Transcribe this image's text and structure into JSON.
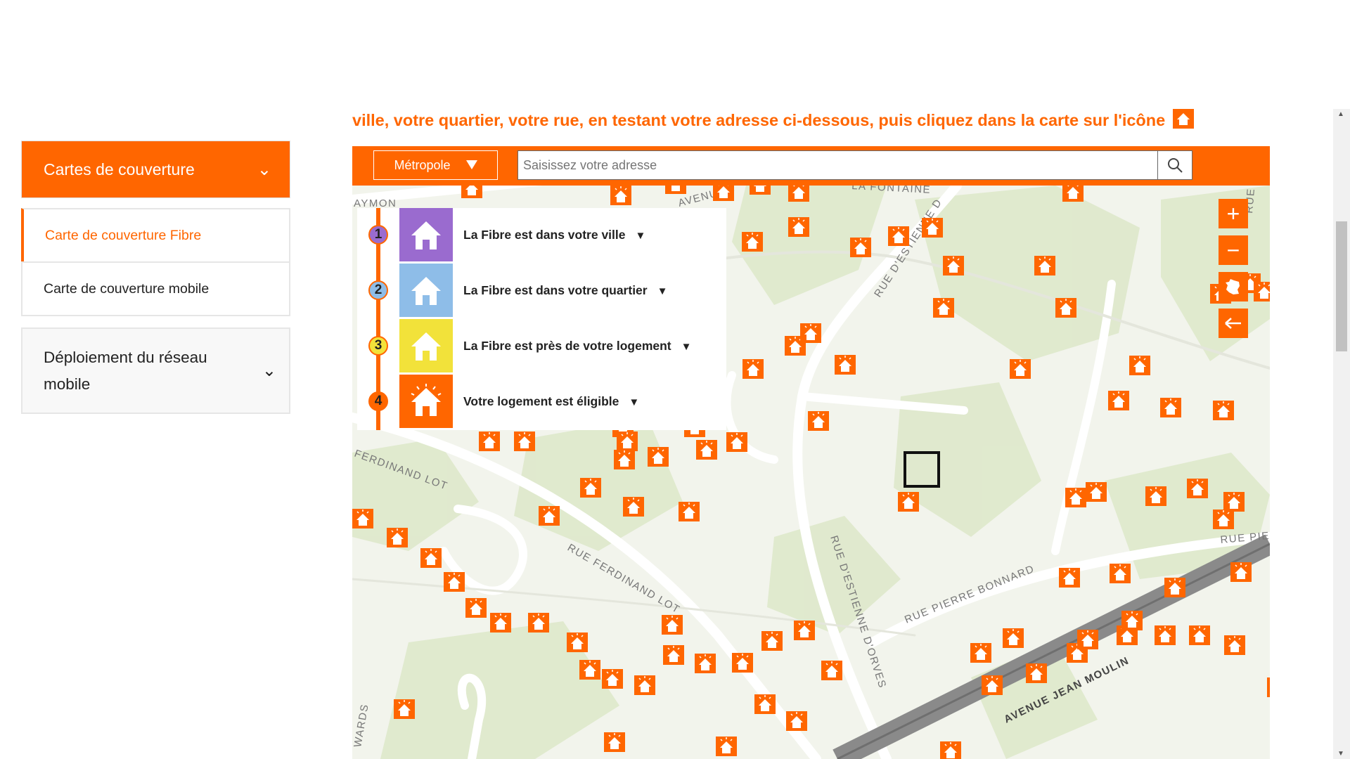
{
  "sidebar": {
    "header": "Cartes de couverture",
    "items": [
      {
        "label": "Carte de couverture Fibre"
      },
      {
        "label": "Carte de couverture mobile"
      }
    ],
    "section2": "Déploiement du réseau mobile"
  },
  "intro": "ville, votre quartier, votre rue, en testant votre adresse ci-dessous, puis cliquez dans la carte sur l'icône",
  "search": {
    "region": "Métropole",
    "placeholder": "Saisissez votre adresse"
  },
  "legend": [
    {
      "num": "1",
      "label": "La Fibre est dans votre ville",
      "color": "#9a6bcf",
      "circle": "#9a6bcf"
    },
    {
      "num": "2",
      "label": "La Fibre est dans votre quartier",
      "color": "#8ebde8",
      "circle": "#8ebde8"
    },
    {
      "num": "3",
      "label": "La Fibre est près de votre logement",
      "color": "#f2e23a",
      "circle": "#f2e23a"
    },
    {
      "num": "4",
      "label": "Votre logement est éligible",
      "color": "#ff6600",
      "circle": "#ff6600"
    }
  ],
  "streets": [
    "AVENUE J",
    "LA FONTAINE",
    "RUE D'ESTIENNE D",
    "AYMON",
    "FERDINAND LOT",
    "RUE FERDINAND LOT",
    "RUE D'ESTIENNE D'ORVES",
    "RUE PIERRE BONNARD",
    "RUE PIE",
    "AVENUE JEAN MOULIN",
    "WARDS",
    "RUE"
  ],
  "colors": {
    "accent": "#ff6600"
  },
  "map_icons": [
    "house-marker-icon"
  ]
}
